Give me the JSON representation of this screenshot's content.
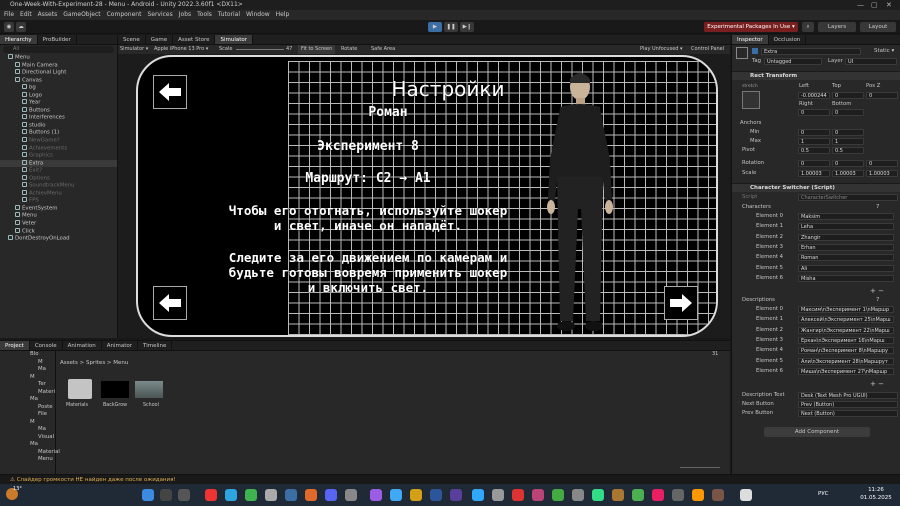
{
  "window": {
    "title": "One-Week-With-Experiment-28 - Menu - Android - Unity 2022.3.60f1 <DX11>"
  },
  "menubar": [
    "File",
    "Edit",
    "Assets",
    "GameObject",
    "Component",
    "Services",
    "Jobs",
    "Tools",
    "Tutorial",
    "Window",
    "Help"
  ],
  "toolbar": {
    "experimental": "Experimental Packages In Use ▾",
    "layers": "Layers",
    "layout": "Layout"
  },
  "hierarchy": {
    "tabs": [
      "Hierarchy",
      "ProBuilder"
    ],
    "search_placeholder": "All",
    "items": [
      {
        "label": "Menu",
        "indent": 0,
        "dim": false
      },
      {
        "label": "Main Camera",
        "indent": 1,
        "dim": false
      },
      {
        "label": "Directional Light",
        "indent": 1,
        "dim": false
      },
      {
        "label": "Canvas",
        "indent": 1,
        "dim": false
      },
      {
        "label": "bg",
        "indent": 2,
        "dim": false
      },
      {
        "label": "Logo",
        "indent": 2,
        "dim": false
      },
      {
        "label": "Year",
        "indent": 2,
        "dim": false
      },
      {
        "label": "Buttons",
        "indent": 2,
        "dim": false
      },
      {
        "label": "Interferences",
        "indent": 2,
        "dim": false
      },
      {
        "label": "studio",
        "indent": 2,
        "dim": false
      },
      {
        "label": "Buttons (1)",
        "indent": 2,
        "dim": false
      },
      {
        "label": "NewGame?",
        "indent": 2,
        "dim": true
      },
      {
        "label": "Achievements",
        "indent": 2,
        "dim": true
      },
      {
        "label": "Graphics",
        "indent": 2,
        "dim": true
      },
      {
        "label": "Extra",
        "indent": 2,
        "dim": false,
        "selected": true
      },
      {
        "label": "Exit?",
        "indent": 2,
        "dim": true
      },
      {
        "label": "Options",
        "indent": 2,
        "dim": true
      },
      {
        "label": "SoundtrackMenu",
        "indent": 2,
        "dim": true
      },
      {
        "label": "AchievMenu",
        "indent": 2,
        "dim": true
      },
      {
        "label": "FPS",
        "indent": 2,
        "dim": true
      },
      {
        "label": "EventSystem",
        "indent": 1,
        "dim": false
      },
      {
        "label": "Menu",
        "indent": 1,
        "dim": false
      },
      {
        "label": "Veter",
        "indent": 1,
        "dim": false
      },
      {
        "label": "Click",
        "indent": 1,
        "dim": false
      },
      {
        "label": "DontDestroyOnLoad",
        "indent": 0,
        "dim": false
      }
    ]
  },
  "scene": {
    "tabs": [
      "Scene",
      "Game",
      "Asset Store",
      "Simulator"
    ],
    "bar": {
      "mode": "Simulator ▾",
      "device": "Apple iPhone 13 Pro ▾",
      "scale_label": "Scale",
      "scale_value": "47",
      "fit": "Fit to Screen",
      "rotate": "Rotate",
      "safe_area": "Safe Area",
      "play_mode": "Play Unfocused ▾",
      "control_panel": "Control Panel"
    },
    "game": {
      "title": "Настройки",
      "name": "Роман",
      "experiment": "Эксперимент 8",
      "route": "Маршрут: С2 → А1",
      "line1": "Чтобы его отогнать, используйте шокер",
      "line2": "и свет, иначе он нападёт.",
      "line3": "Следите за его движением по камерам и",
      "line4": "будьте готовы вовремя применить шокер",
      "line5": "и включить свет."
    }
  },
  "inspector": {
    "tabs": [
      "Inspector",
      "Occlusion"
    ],
    "object_name": "Extra",
    "static": "Static ▾",
    "tag_label": "Tag",
    "tag": "Untagged",
    "layer_label": "Layer",
    "layer": "UI",
    "rect_transform": "Rect Transform",
    "stretch": "stretch",
    "left_label": "Left",
    "top_label": "Top",
    "posz_label": "Pos Z",
    "left": "-0.000244",
    "top": "0",
    "posz": "0",
    "right_label": "Right",
    "bottom_label": "Bottom",
    "right": "0",
    "bottom": "0",
    "anchors": "Anchors",
    "min": "Min",
    "max": "Max",
    "pivot": "Pivot",
    "min_x": "0",
    "min_y": "0",
    "max_x": "1",
    "max_y": "1",
    "pivot_x": "0.5",
    "pivot_y": "0.5",
    "rotation": "Rotation",
    "rot_x": "0",
    "rot_y": "0",
    "rot_z": "0",
    "scale": "Scale",
    "scale_x": "1.00003",
    "scale_y": "1.00003",
    "scale_z": "1.00003",
    "component": "Character Switcher (Script)",
    "script_label": "Script",
    "script": "CharacterSwitcher",
    "characters_label": "Characters",
    "characters_count": "7",
    "characters": [
      {
        "label": "Element 0",
        "value": "Maksim"
      },
      {
        "label": "Element 1",
        "value": "Leha"
      },
      {
        "label": "Element 2",
        "value": "Zhangir"
      },
      {
        "label": "Element 3",
        "value": "Erhan"
      },
      {
        "label": "Element 4",
        "value": "Roman"
      },
      {
        "label": "Element 5",
        "value": "Ali"
      },
      {
        "label": "Element 6",
        "value": "Misha"
      }
    ],
    "descriptions_label": "Descriptions",
    "descriptions_count": "7",
    "descriptions": [
      {
        "label": "Element 0",
        "value": "Максим\\nЭксперимент 1\\nМаршр"
      },
      {
        "label": "Element 1",
        "value": "Алексей\\nЭксперимент 25\\nМарш"
      },
      {
        "label": "Element 2",
        "value": "Жангир\\nЭксперимент 22\\nМарш"
      },
      {
        "label": "Element 3",
        "value": "Еркан\\nЭксперимент 16\\nМарш"
      },
      {
        "label": "Element 4",
        "value": "Роман\\nЭксперимент 8\\nМаршру"
      },
      {
        "label": "Element 5",
        "value": "Али\\nЭксперимент 28\\nМаршрут"
      },
      {
        "label": "Element 6",
        "value": "Миша\\nЭксперимент 27\\nМаршр"
      }
    ],
    "desc_text_label": "Description Text",
    "desc_text": "Desk (Text Mesh Pro UGUI)",
    "next_label": "Next Button",
    "next": "Prev (Button)",
    "prev_label": "Prev Button",
    "prev": "Next (Button)",
    "add_component": "Add Component"
  },
  "project": {
    "tabs": [
      "Project",
      "Console",
      "Animation",
      "Animator",
      "Timeline"
    ],
    "breadcrumb": "Assets > Sprites > Menu",
    "tree": [
      "Blo",
      "M",
      "Ma",
      "M",
      "Ter",
      "Materi",
      "Ma",
      "Poste",
      "File",
      "M",
      "Ma",
      "Visual",
      "Ma",
      "Material",
      "Menu"
    ],
    "assets": [
      {
        "name": "Materials",
        "kind": "folder"
      },
      {
        "name": "BackGrow",
        "kind": "black"
      },
      {
        "name": "School",
        "kind": "image"
      }
    ],
    "count": "31"
  },
  "status": {
    "message": "Слайдер громкости НЕ найден даже после ожидания!"
  },
  "taskbar": {
    "weather": "13°",
    "lang": "РУС",
    "time": "11:26",
    "date": "01.05.2025"
  }
}
